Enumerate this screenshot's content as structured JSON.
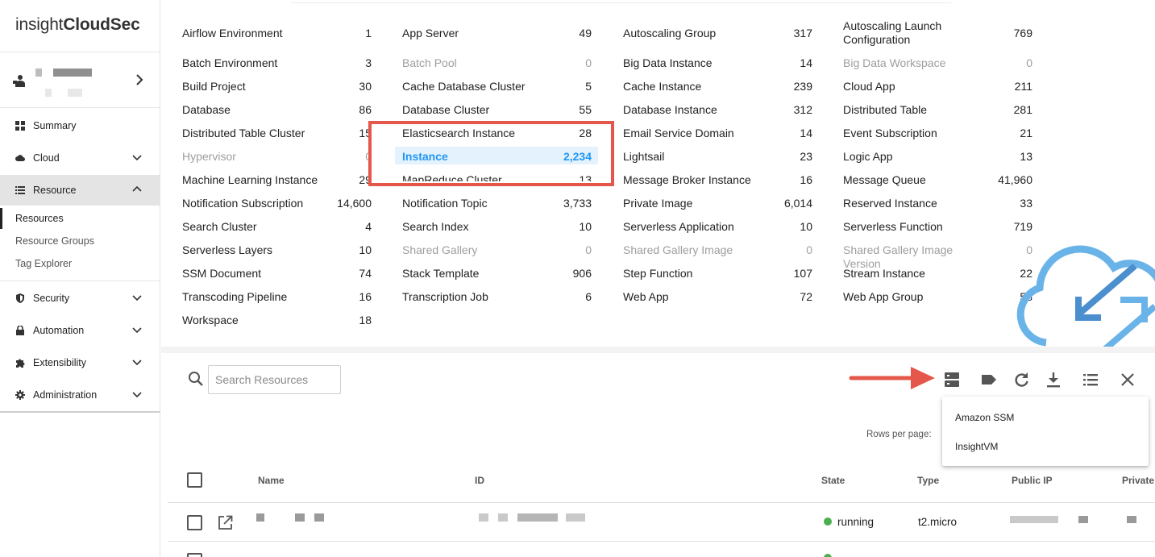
{
  "app": {
    "logo_regular": "insight",
    "logo_bold": "CloudSec"
  },
  "sidebar": {
    "items": [
      {
        "label": "Summary",
        "icon": "grid-icon"
      },
      {
        "label": "Cloud",
        "icon": "cloud-icon"
      },
      {
        "label": "Resource",
        "icon": "list-icon"
      },
      {
        "label": "Security",
        "icon": "shield-icon"
      },
      {
        "label": "Automation",
        "icon": "lock-icon"
      },
      {
        "label": "Extensibility",
        "icon": "puzzle-icon"
      },
      {
        "label": "Administration",
        "icon": "gear-icon"
      }
    ],
    "resource_subitems": [
      "Resources",
      "Resource Groups",
      "Tag Explorer"
    ]
  },
  "resources": [
    {
      "name": "Airflow Environment",
      "count": "1"
    },
    {
      "name": "App Server",
      "count": "49"
    },
    {
      "name": "Autoscaling Group",
      "count": "317"
    },
    {
      "name": "Autoscaling Launch Configuration",
      "count": "769"
    },
    {
      "name": "Batch Environment",
      "count": "3"
    },
    {
      "name": "Batch Pool",
      "count": "0",
      "dim": true
    },
    {
      "name": "Big Data Instance",
      "count": "14"
    },
    {
      "name": "Big Data Workspace",
      "count": "0",
      "dim": true
    },
    {
      "name": "Build Project",
      "count": "30"
    },
    {
      "name": "Cache Database Cluster",
      "count": "5"
    },
    {
      "name": "Cache Instance",
      "count": "239"
    },
    {
      "name": "Cloud App",
      "count": "211"
    },
    {
      "name": "Database",
      "count": "86"
    },
    {
      "name": "Database Cluster",
      "count": "55"
    },
    {
      "name": "Database Instance",
      "count": "312"
    },
    {
      "name": "Distributed Table",
      "count": "281"
    },
    {
      "name": "Distributed Table Cluster",
      "count": "15"
    },
    {
      "name": "Elasticsearch Instance",
      "count": "28"
    },
    {
      "name": "Email Service Domain",
      "count": "14"
    },
    {
      "name": "Event Subscription",
      "count": "21"
    },
    {
      "name": "Hypervisor",
      "count": "0",
      "dim": true
    },
    {
      "name": "Instance",
      "count": "2,234",
      "selected": true
    },
    {
      "name": "Lightsail",
      "count": "23"
    },
    {
      "name": "Logic App",
      "count": "13"
    },
    {
      "name": "Machine Learning Instance",
      "count": "29"
    },
    {
      "name": "MapReduce Cluster",
      "count": "13"
    },
    {
      "name": "Message Broker Instance",
      "count": "16"
    },
    {
      "name": "Message Queue",
      "count": "41,960"
    },
    {
      "name": "Notification Subscription",
      "count": "14,600"
    },
    {
      "name": "Notification Topic",
      "count": "3,733"
    },
    {
      "name": "Private Image",
      "count": "6,014"
    },
    {
      "name": "Reserved Instance",
      "count": "33"
    },
    {
      "name": "Search Cluster",
      "count": "4"
    },
    {
      "name": "Search Index",
      "count": "10"
    },
    {
      "name": "Serverless Application",
      "count": "10"
    },
    {
      "name": "Serverless Function",
      "count": "719"
    },
    {
      "name": "Serverless Layers",
      "count": "10"
    },
    {
      "name": "Shared Gallery",
      "count": "0",
      "dim": true
    },
    {
      "name": "Shared Gallery Image",
      "count": "0",
      "dim": true
    },
    {
      "name": "Shared Gallery Image Version",
      "count": "0",
      "dim": true
    },
    {
      "name": "SSM Document",
      "count": "74"
    },
    {
      "name": "Stack Template",
      "count": "906"
    },
    {
      "name": "Step Function",
      "count": "107"
    },
    {
      "name": "Stream Instance",
      "count": "22"
    },
    {
      "name": "Transcoding Pipeline",
      "count": "16"
    },
    {
      "name": "Transcription Job",
      "count": "6"
    },
    {
      "name": "Web App",
      "count": "72"
    },
    {
      "name": "Web App Group",
      "count": "58"
    },
    {
      "name": "Workspace",
      "count": "18"
    }
  ],
  "search": {
    "placeholder": "Search Resources"
  },
  "toolbar": {
    "icons": [
      "server-icon",
      "tag-icon",
      "refresh-icon",
      "download-icon",
      "list-icon",
      "close-icon"
    ]
  },
  "dropdown": {
    "items": [
      "Amazon SSM",
      "InsightVM"
    ]
  },
  "table": {
    "rows_per_page_label": "Rows per page:",
    "columns": [
      "Name",
      "ID",
      "State",
      "Type",
      "Public IP",
      "Private"
    ],
    "rows": [
      {
        "state": "running",
        "type": "t2.micro"
      }
    ]
  },
  "colors": {
    "accent": "#2196f3",
    "callout": "#e4574a",
    "running": "#4caf50"
  }
}
